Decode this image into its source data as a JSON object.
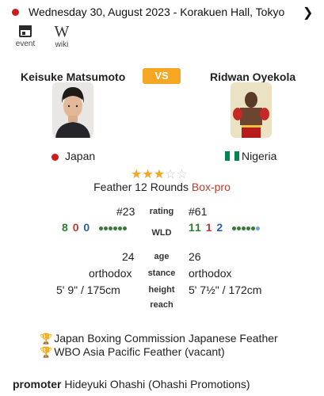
{
  "header": {
    "text": "Wednesday 30, August 2023  -  Korakuen Hall, Tokyo"
  },
  "links": [
    {
      "label": "event",
      "icon": "calendar-icon"
    },
    {
      "label": "wiki",
      "icon": "wikipedia-icon"
    }
  ],
  "vs_label": "VS",
  "left": {
    "name": "Keisuke Matsumoto",
    "country": "Japan",
    "rating": "#23",
    "wld": {
      "w": "8",
      "l": "0",
      "d": "0"
    },
    "form": [
      "win",
      "win",
      "win",
      "win",
      "win",
      "win"
    ],
    "age": "24",
    "stance": "orthodox",
    "height": "5' 9\"  /  175cm"
  },
  "right": {
    "name": "Ridwan Oyekola",
    "country": "Nigeria",
    "rating": "#61",
    "wld": {
      "w": "11",
      "l": "1",
      "d": "2"
    },
    "form": [
      "win",
      "win",
      "win",
      "win",
      "win",
      "draw"
    ],
    "age": "26",
    "stance": "orthodox",
    "height": "5' 7½\"  /  172cm"
  },
  "rating": {
    "stars": 3,
    "max": 5
  },
  "bout": {
    "division_rounds": "Feather 12 Rounds",
    "type": "Box-pro"
  },
  "labels": {
    "rating": "rating",
    "wld": "WLD",
    "age": "age",
    "stance": "stance",
    "height": "height",
    "reach": "reach"
  },
  "titles": [
    "Japan Boxing Commission Japanese Feather",
    "WBO Asia Pacific Feather (vacant)"
  ],
  "promoter": {
    "label": "promoter",
    "value": "Hideyuki Ohashi (Ohashi Promotions)"
  },
  "colors": {
    "accent": "#f5a623",
    "win": "#2e7d32",
    "loss": "#c0392b",
    "draw": "#2962a8",
    "japan": "#d11b1b",
    "nigeria": "#008751"
  }
}
